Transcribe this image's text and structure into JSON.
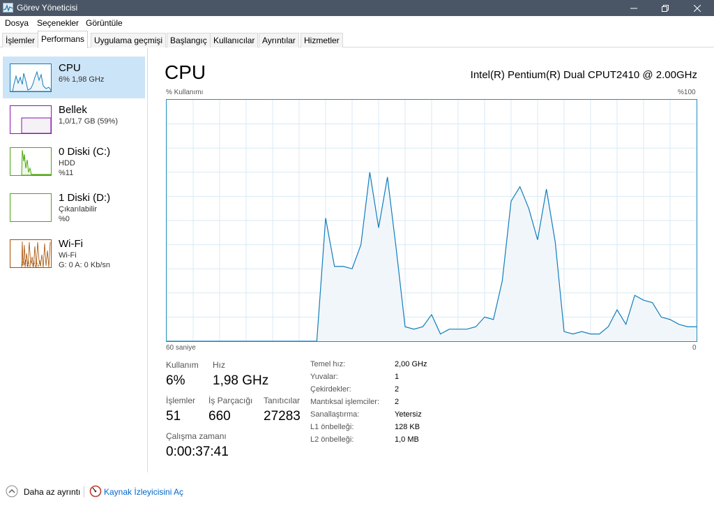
{
  "window": {
    "title": "Görev Yöneticisi",
    "icon": "task-manager-icon"
  },
  "menu": [
    "Dosya",
    "Seçenekler",
    "Görüntüle"
  ],
  "tabs": [
    "İşlemler",
    "Performans",
    "Uygulama geçmişi",
    "Başlangıç",
    "Kullanıcılar",
    "Ayrıntılar",
    "Hizmetler"
  ],
  "active_tab": "Performans",
  "sidebar": {
    "items": [
      {
        "title": "CPU",
        "lines": [
          "6%  1,98 GHz"
        ],
        "color": "#117dbb",
        "active": true
      },
      {
        "title": "Bellek",
        "lines": [
          "1,0/1,7 GB (59%)"
        ],
        "color": "#8b12ae",
        "active": false
      },
      {
        "title": "0 Diski (C:)",
        "lines": [
          "HDD",
          "%11"
        ],
        "color": "#4da60c",
        "active": false
      },
      {
        "title": "1 Diski (D:)",
        "lines": [
          "Çıkarılabilir",
          "%0"
        ],
        "color": "#4da60c",
        "active": false
      },
      {
        "title": "Wi-Fi",
        "lines": [
          "Wi-Fi",
          "G: 0 A: 0 Kb/sn"
        ],
        "color": "#a74f01",
        "active": false
      }
    ]
  },
  "cpu": {
    "heading": "CPU",
    "model": "Intel(R) Pentium(R) Dual CPUT2410 @ 2.00GHz",
    "graph_top_left": "% Kullanımı",
    "graph_top_right": "%100",
    "graph_bottom_left": "60 saniye",
    "graph_bottom_right": "0",
    "line_color": "#117dbb",
    "fill_color": "#f1f6fa",
    "grid_color": "#d9eaf4"
  },
  "chart_data": {
    "type": "area",
    "ylim": [
      0,
      100
    ],
    "xlim": [
      60,
      0
    ],
    "x": [
      60,
      43,
      42,
      41,
      40,
      39,
      38,
      37,
      36,
      35,
      34,
      33,
      32,
      31,
      30,
      29,
      28,
      27,
      26,
      25,
      24,
      23,
      22,
      21,
      20,
      19,
      18,
      17,
      16,
      15,
      14,
      13,
      12,
      11,
      10,
      9,
      8,
      7,
      6,
      5,
      4,
      3,
      2,
      1,
      0
    ],
    "values": [
      0,
      0,
      51,
      31,
      31,
      30,
      40,
      70,
      47,
      68,
      38,
      6,
      5,
      6,
      11,
      3,
      5,
      5,
      5,
      6,
      10,
      9,
      25,
      58,
      64,
      55,
      42,
      63,
      41,
      4,
      3,
      4,
      3,
      3,
      6,
      13,
      7,
      19,
      17,
      16,
      10,
      9,
      7,
      6,
      6
    ]
  },
  "stats": {
    "usage_label": "Kullanım",
    "usage_value": "6%",
    "speed_label": "Hız",
    "speed_value": "1,98 GHz",
    "processes_label": "İşlemler",
    "processes_value": "51",
    "threads_label": "İş Parçacığı",
    "threads_value": "660",
    "handles_label": "Tanıtıcılar",
    "handles_value": "27283",
    "uptime_label": "Çalışma zamanı",
    "uptime_value": "0:00:37:41"
  },
  "info": [
    {
      "label": "Temel hız:",
      "value": "2,00 GHz"
    },
    {
      "label": "Yuvalar:",
      "value": "1"
    },
    {
      "label": "Çekirdekler:",
      "value": "2"
    },
    {
      "label": "Mantıksal işlemciler:",
      "value": "2"
    },
    {
      "label": "Sanallaştırma:",
      "value": "Yetersiz"
    },
    {
      "label": "L1 önbelleği:",
      "value": "128 KB"
    },
    {
      "label": "L2 önbelleği:",
      "value": "1,0 MB"
    }
  ],
  "bottom": {
    "fewer_details": "Daha az ayrıntı",
    "open_monitor": "Kaynak İzleyicisini Aç",
    "link_color": "#0066cc"
  }
}
